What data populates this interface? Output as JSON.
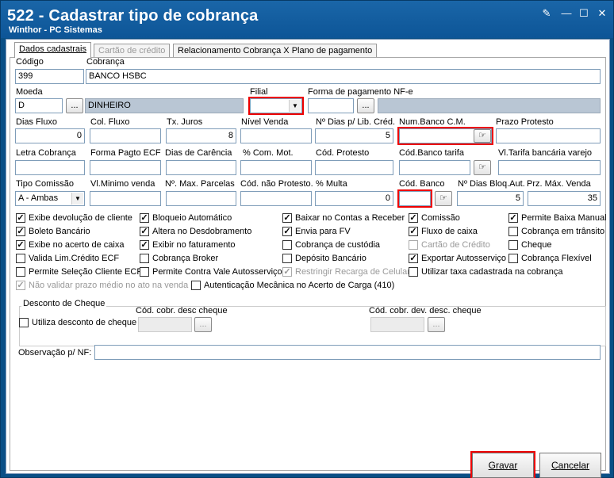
{
  "window": {
    "title": "522 - Cadastrar tipo de cobrança",
    "subtitle": "Winthor - PC Sistemas"
  },
  "tabs": [
    "Dados cadastrais",
    "Cartão de crédito",
    "Relacionamento Cobrança X Plano de pagamento"
  ],
  "labels": {
    "codigo": "Código",
    "cobranca": "Cobrança",
    "moeda": "Moeda",
    "filial": "Filial",
    "forma_pag_nfe": "Forma de pagamento NF-e",
    "dias_fluxo": "Dias Fluxo",
    "col_fluxo": "Col. Fluxo",
    "tx_juros": "Tx. Juros",
    "nivel_venda": "Nível Venda",
    "n_dias_lib_cred": "Nº Dias p/ Lib. Créd.",
    "num_banco_cm": "Num.Banco C.M.",
    "prazo_protesto": "Prazo Protesto",
    "letra_cobranca": "Letra Cobrança",
    "forma_pagto_ecf": "Forma Pagto ECF",
    "dias_carencia": "Dias de Carência",
    "com_mot": "% Com. Mot.",
    "cod_protesto": "Cód. Protesto",
    "cod_banco_tarifa": "Cód.Banco tarifa",
    "vl_tarifa": "Vl.Tarifa bancária varejo",
    "tipo_comissao": "Tipo Comissão",
    "vl_minimo_venda": "Vl.Minimo venda",
    "n_max_parcelas": "Nº. Max. Parcelas",
    "cod_nao_protesto": "Cód. não Protesto.",
    "multa": "% Multa",
    "cod_banco": "Cód. Banco",
    "n_dias_bloq_aut": "Nº Dias Bloq.Aut.",
    "prz_max_venda": "Prz. Máx. Venda",
    "observacao": "Observação p/ NF:"
  },
  "values": {
    "codigo": "399",
    "cobranca": "BANCO HSBC",
    "moeda": "D",
    "moeda_desc": "DINHEIRO",
    "dias_fluxo": "0",
    "tx_juros": "8",
    "n_dias_lib_cred": "5",
    "tipo_comissao": "A - Ambas",
    "multa": "0",
    "n_dias_bloq_aut": "5",
    "prz_max_venda": "35"
  },
  "checkboxes": [
    {
      "label": "Exibe devolução de cliente",
      "checked": true
    },
    {
      "label": "Boleto Bancário",
      "checked": true
    },
    {
      "label": "Exibe no acerto de caixa",
      "checked": true
    },
    {
      "label": "Valida Lim.Crédito ECF",
      "checked": false
    },
    {
      "label": "Permite Seleção Cliente ECF",
      "checked": false
    },
    {
      "label": "Bloqueio Automático",
      "checked": true
    },
    {
      "label": "Altera no Desdobramento",
      "checked": true
    },
    {
      "label": "Exibir no faturamento",
      "checked": true
    },
    {
      "label": "Cobrança Broker",
      "checked": false
    },
    {
      "label": "Permite Contra Vale Autosserviço",
      "checked": false
    },
    {
      "label": "Baixar no Contas a Receber",
      "checked": true
    },
    {
      "label": "Envia para FV",
      "checked": true
    },
    {
      "label": "Cobrança de custódia",
      "checked": false
    },
    {
      "label": "Depósito Bancário",
      "checked": false
    },
    {
      "label": "Restringir Recarga de Celular",
      "checked": true
    },
    {
      "label": "Comissão",
      "checked": true
    },
    {
      "label": "Fluxo de caixa",
      "checked": true
    },
    {
      "label": "Cartão de Crédito",
      "checked": false
    },
    {
      "label": "Exportar Autosserviço",
      "checked": true
    },
    {
      "label": "Utilizar taxa cadastrada na cobrança",
      "checked": false
    },
    {
      "label": "Permite Baixa Manual",
      "checked": true
    },
    {
      "label": "Cobrança em trânsito",
      "checked": false
    },
    {
      "label": "Cheque",
      "checked": false
    },
    {
      "label": "Cobrança Flexível",
      "checked": false
    },
    {
      "label": "Não validar prazo médio no ato na venda",
      "checked": true
    },
    {
      "label": "Autenticação Mecânica no Acerto de Carga (410)",
      "checked": false
    }
  ],
  "desconto": {
    "title": "Desconto de Cheque",
    "utiliza": "Utiliza desconto de cheque",
    "cod_desc": "Cód. cobr. desc cheque",
    "cod_dev_desc": "Cód. cobr. dev. desc. cheque"
  },
  "buttons": {
    "ellipsis": "...",
    "gravar": "Gravar",
    "cancelar": "Cancelar"
  },
  "icons": {
    "hand": "☞"
  }
}
